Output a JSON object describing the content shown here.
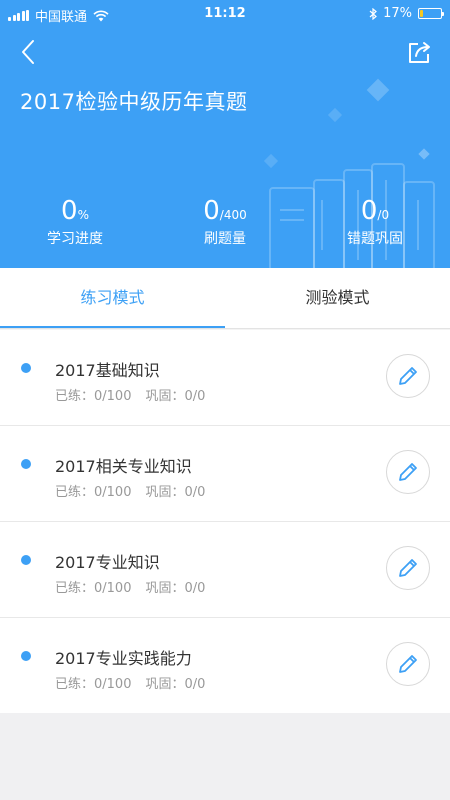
{
  "status_bar": {
    "carrier": "中国联通",
    "time": "11:12",
    "battery": "17%",
    "battery_level": 0.17
  },
  "header": {
    "title": "2017检验中级历年真题",
    "back_icon": "back-chevron-icon",
    "share_icon": "share-icon",
    "colors": {
      "background": "#3da0f5"
    }
  },
  "stats": [
    {
      "value": "0",
      "suffix": "%",
      "label": "学习进度"
    },
    {
      "value": "0",
      "suffix": "/400",
      "label": "刷题量"
    },
    {
      "value": "0",
      "suffix": "/0",
      "label": "错题巩固"
    }
  ],
  "tabs": [
    {
      "label": "练习模式",
      "active": true
    },
    {
      "label": "测验模式",
      "active": false
    }
  ],
  "items": [
    {
      "name": "2017基础知识",
      "practiced": "已练：0/100",
      "review": "巩固：0/0"
    },
    {
      "name": "2017相关专业知识",
      "practiced": "已练：0/100",
      "review": "巩固：0/0"
    },
    {
      "name": " 2017专业知识",
      "practiced": "已练：0/100",
      "review": "巩固：0/0"
    },
    {
      "name": " 2017专业实践能力",
      "practiced": "已练：0/100",
      "review": "巩固：0/0"
    }
  ],
  "colors": {
    "accent": "#3da0f5",
    "battery_fill": "#f7c81e"
  }
}
